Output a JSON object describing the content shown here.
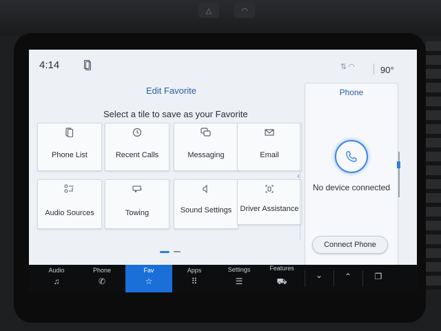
{
  "status": {
    "time": "4:14",
    "temperature": "90°"
  },
  "main": {
    "title": "Edit Favorite",
    "subtitle": "Select a tile to save as your Favorite",
    "tiles": [
      {
        "label": "Phone List",
        "icon": "phone-list-icon"
      },
      {
        "label": "Recent Calls",
        "icon": "clock-icon"
      },
      {
        "label": "Messaging",
        "icon": "chat-icon"
      },
      {
        "label": "Email",
        "icon": "envelope-icon"
      },
      {
        "label": "Audio Sources",
        "icon": "audio-sources-icon"
      },
      {
        "label": "Towing",
        "icon": "trailer-icon"
      },
      {
        "label": "Sound Settings",
        "icon": "speaker-icon"
      },
      {
        "label": "Driver Assistance",
        "icon": "driver-assist-icon"
      }
    ],
    "page_count": 2,
    "current_page": 1
  },
  "phone_panel": {
    "title": "Phone",
    "status": "No device connected",
    "connect_label": "Connect Phone"
  },
  "navbar": {
    "items": [
      {
        "label": "Audio",
        "icon": "music-note-icon"
      },
      {
        "label": "Phone",
        "icon": "phone-icon"
      },
      {
        "label": "Fav",
        "icon": "stars-icon",
        "active": true
      },
      {
        "label": "Apps",
        "icon": "grid-icon"
      },
      {
        "label": "Settings",
        "icon": "sliders-icon"
      },
      {
        "label": "Features",
        "icon": "truck-icon"
      }
    ]
  },
  "colors": {
    "accent": "#2d7fe0",
    "title_blue": "#2b5ea8",
    "nav_active": "#1a6fd9"
  }
}
